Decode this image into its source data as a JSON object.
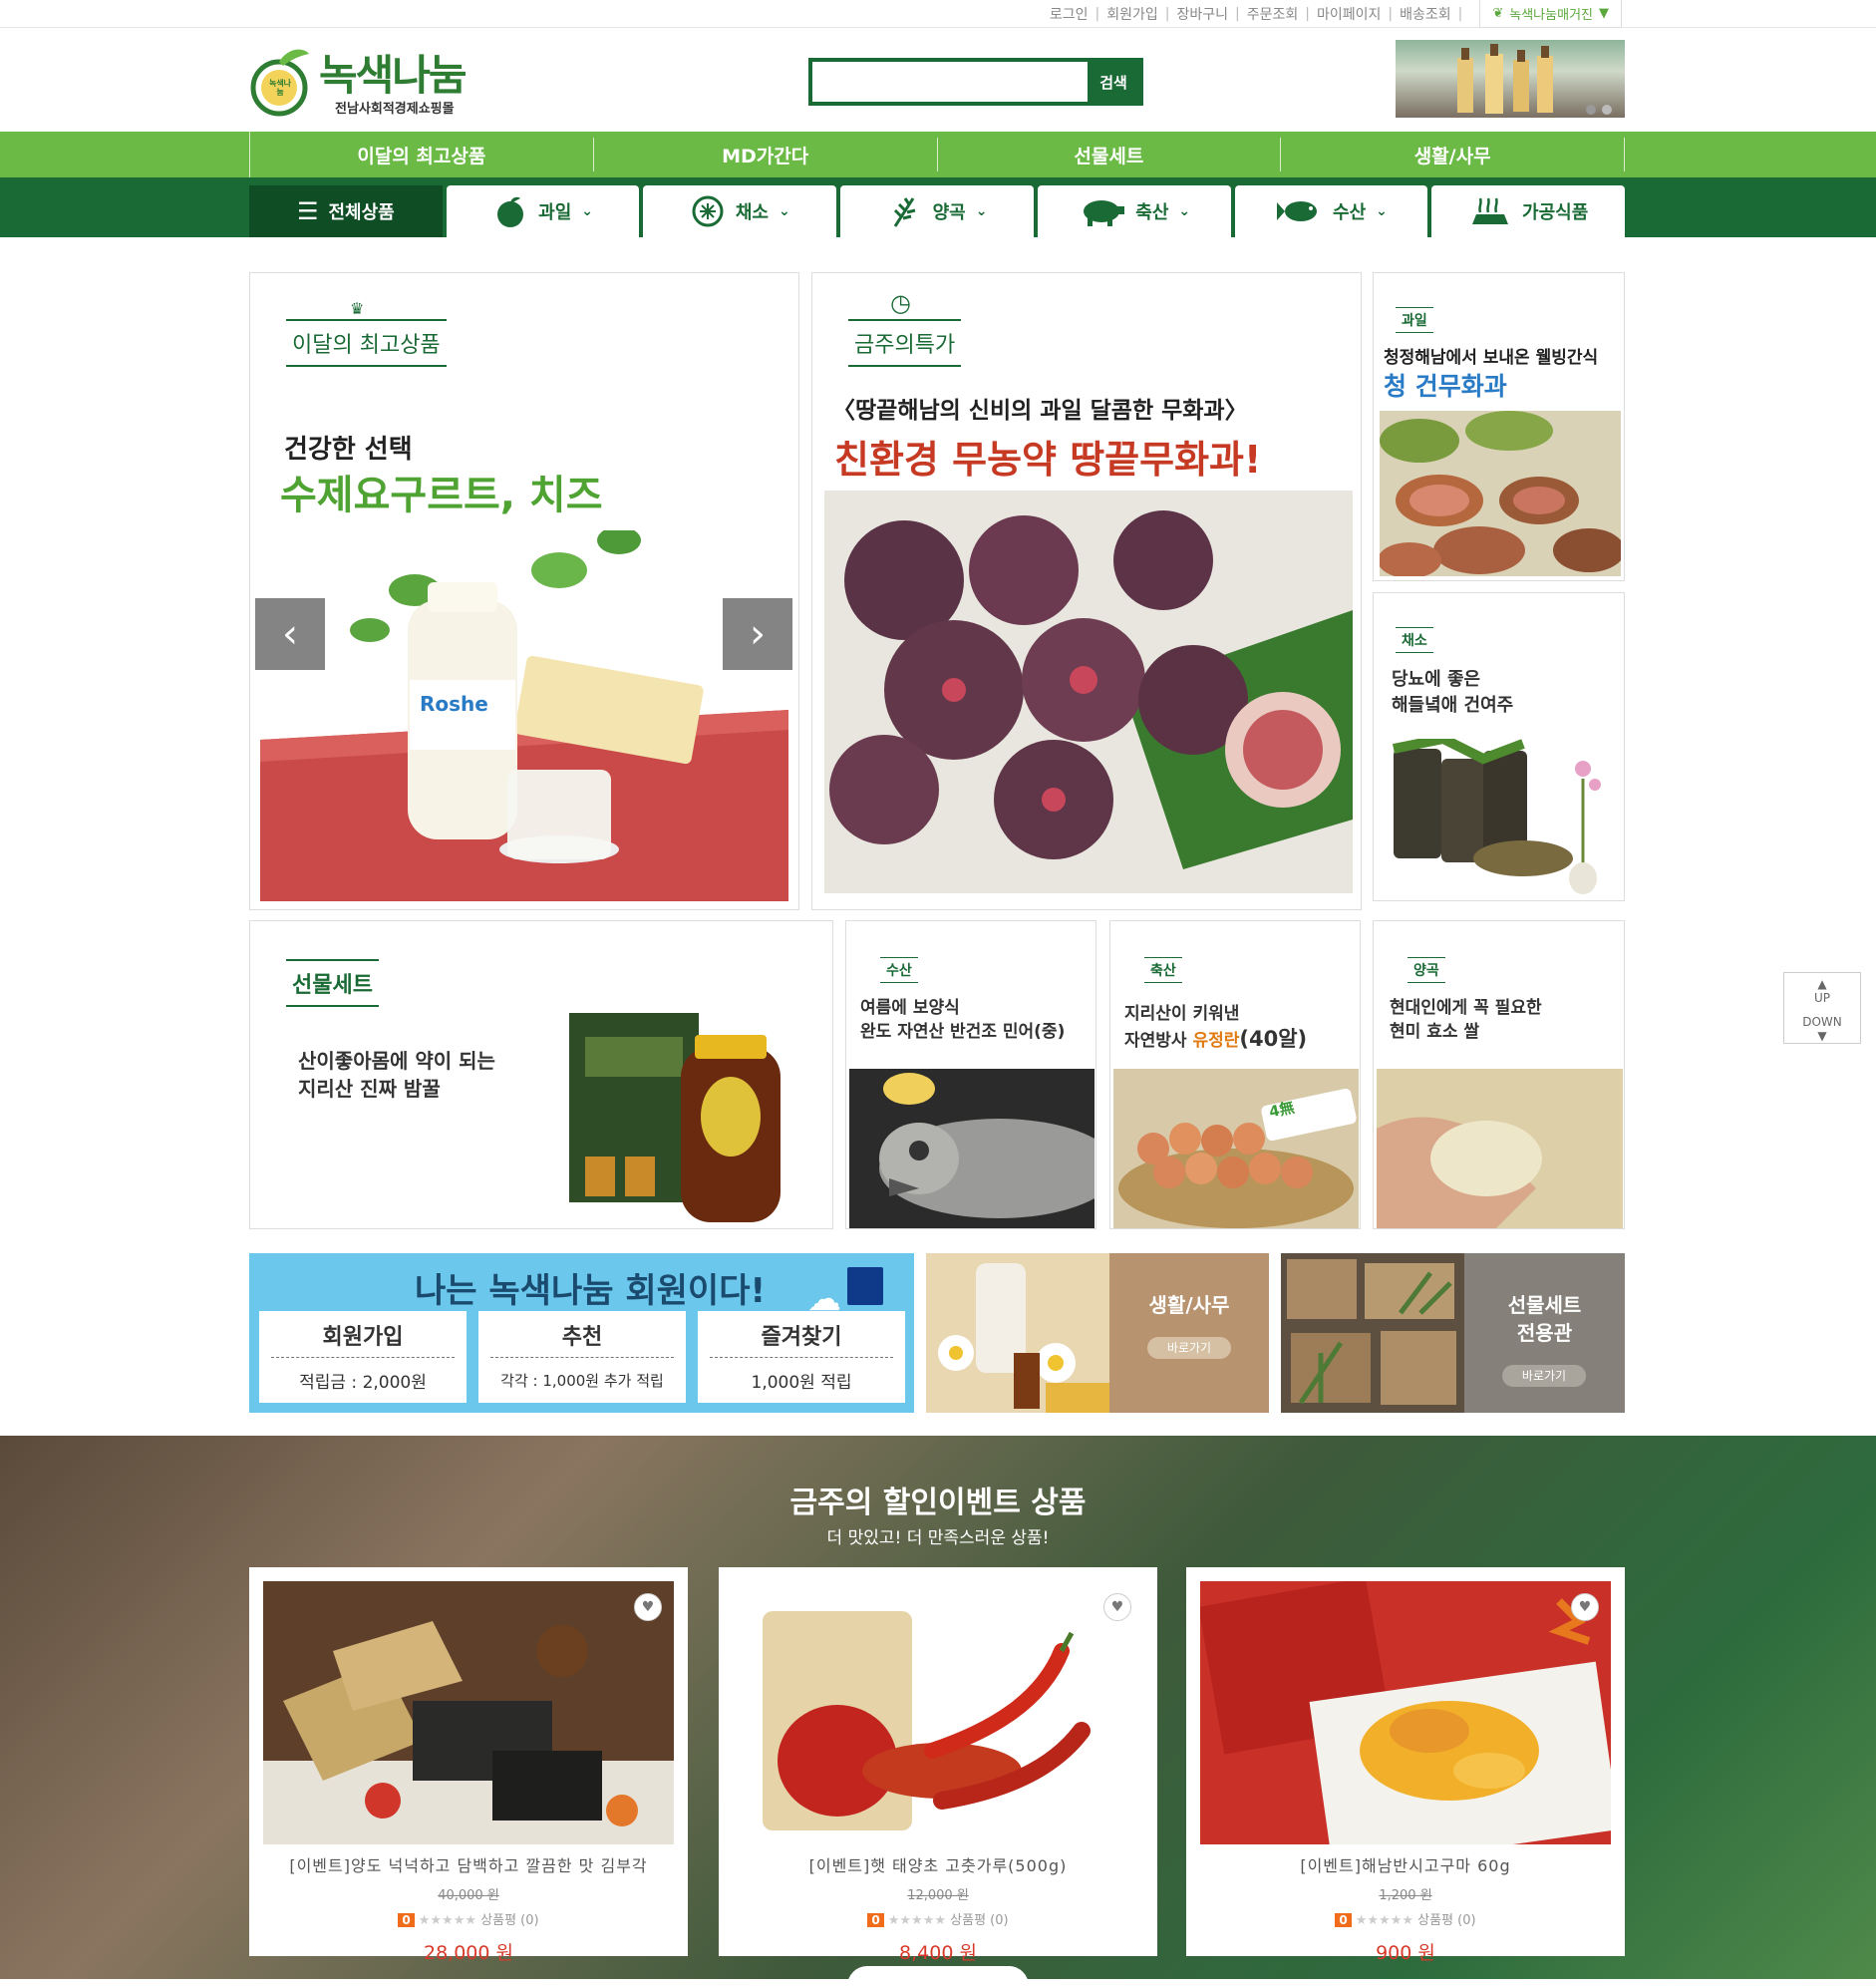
{
  "toplinks": [
    "로그인",
    "회원가입",
    "장바구니",
    "주문조회",
    "마이페이지",
    "배송조회"
  ],
  "magazine_label": "녹색나눔매거진",
  "logo": {
    "name": "녹색나눔",
    "tagline": "전남사회적경제쇼핑몰",
    "badge": "녹색나눔"
  },
  "search": {
    "button": "검색",
    "placeholder": ""
  },
  "nav_primary": [
    "이달의 최고상품",
    "MD가간다",
    "선물세트",
    "생활/사무"
  ],
  "nav_categories": [
    {
      "label": "전체상품",
      "icon": "menu-icon"
    },
    {
      "label": "과일",
      "icon": "apple-icon"
    },
    {
      "label": "채소",
      "icon": "vegetable-icon"
    },
    {
      "label": "양곡",
      "icon": "grain-icon"
    },
    {
      "label": "축산",
      "icon": "pig-icon"
    },
    {
      "label": "수산",
      "icon": "fish-icon"
    },
    {
      "label": "가공식품",
      "icon": "processed-food-icon"
    }
  ],
  "best": {
    "title": "이달의 최고상품",
    "line1": "건강한 선택",
    "line2": "수제요구르트, 치즈",
    "bottle_label": "Roshe"
  },
  "weekly": {
    "title": "금주의특가",
    "line1": "〈땅끝해남의 신비의 과일 달콤한 무화과〉",
    "line2": "친환경 무농약 땅끝무화과!"
  },
  "side1": {
    "tag": "과일",
    "line1": "청정해남에서 보내온 웰빙간식",
    "line2": "청 건무화과"
  },
  "side2": {
    "tag": "채소",
    "line1": "당뇨에 좋은",
    "line2": "해들녘애 건여주"
  },
  "gift": {
    "title": "선물세트",
    "line1": "산이좋아몸에 약이 되는",
    "line2": "지리산 진짜 밤꿀"
  },
  "tile_fish": {
    "tag": "수산",
    "line1": "여름에 보양식",
    "line2": "완도 자연산 반건조 민어(중)"
  },
  "tile_egg": {
    "tag": "축산",
    "line1": "지리산이 키워낸",
    "line2a": "자연방사 ",
    "line2b": "유정란",
    "line2c": "(40알)",
    "badge": "4無"
  },
  "tile_rice": {
    "tag": "양곡",
    "line1": "현대인에게 꼭 필요한",
    "line2": "현미 효소 쌀"
  },
  "member": {
    "headline": "나는 녹색나눔 회원이다!",
    "boxes": [
      {
        "title": "회원가입",
        "desc": "적립금 : 2,000원"
      },
      {
        "title": "추천",
        "desc": "각각 : 1,000원 추가 적립"
      },
      {
        "title": "즐겨찾기",
        "desc": "1,000원 적립"
      }
    ]
  },
  "banner_life": {
    "title": "생활/사무",
    "button": "바로가기"
  },
  "banner_gift": {
    "title1": "선물세트",
    "title2": "전용관",
    "button": "바로가기"
  },
  "updown": {
    "up": "UP",
    "down": "DOWN"
  },
  "event": {
    "title": "금주의 할인이벤트 상품",
    "subtitle": "더 맛있고! 더 만족스러운 상품!",
    "products": [
      {
        "name": "[이벤트]양도 넉넉하고 담백하고 깔끔한 맛 김부각",
        "orig": "40,000 원",
        "review": "상품평 (0)",
        "price": "28,000 원"
      },
      {
        "name": "[이벤트]햇 태양초 고춧가루(500g)",
        "orig": "12,000 원",
        "review": "상품평 (0)",
        "price": "8,400 원"
      },
      {
        "name": "[이벤트]해남반시고구마 60g",
        "orig": "1,200 원",
        "review": "상품평 (0)",
        "price": "900 원"
      }
    ]
  },
  "colors": {
    "dark_green": "#1a6a35",
    "light_green": "#6aba45",
    "price_red": "#d73a2a",
    "sale_orange": "#f06b1a",
    "sky_blue": "#6cc7ec"
  }
}
